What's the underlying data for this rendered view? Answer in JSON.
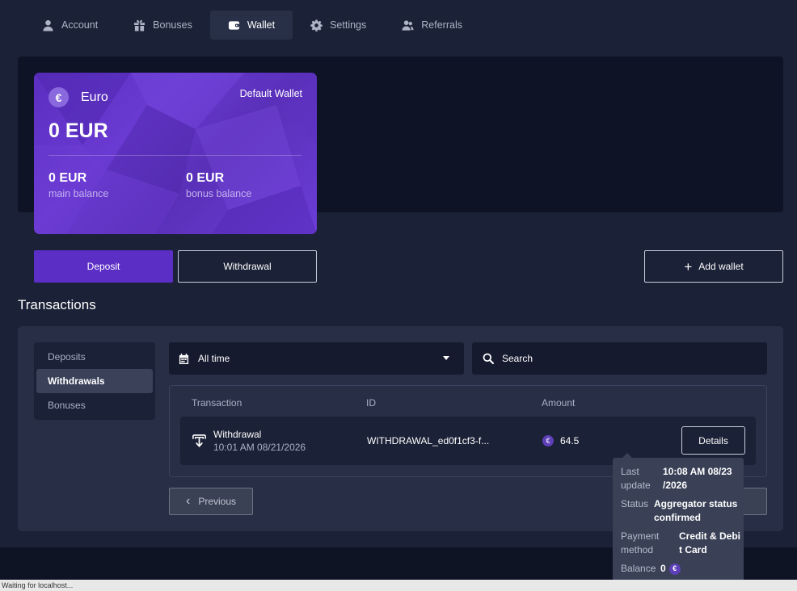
{
  "tabs": [
    {
      "label": "Account",
      "icon": "user-icon"
    },
    {
      "label": "Bonuses",
      "icon": "gift-icon"
    },
    {
      "label": "Wallet",
      "icon": "wallet-icon",
      "active": true
    },
    {
      "label": "Settings",
      "icon": "gear-icon"
    },
    {
      "label": "Referrals",
      "icon": "users-icon"
    }
  ],
  "wallet_card": {
    "currency_symbol": "€",
    "currency": "Euro",
    "default_label": "Default Wallet",
    "total": "0 EUR",
    "main_amount": "0 EUR",
    "main_label": "main balance",
    "bonus_amount": "0 EUR",
    "bonus_label": "bonus balance"
  },
  "actions": {
    "deposit": "Deposit",
    "withdrawal": "Withdrawal",
    "add_wallet": "Add wallet"
  },
  "transactions": {
    "title": "Transactions",
    "menu": [
      {
        "label": "Deposits",
        "active": false
      },
      {
        "label": "Withdrawals",
        "active": true
      },
      {
        "label": "Bonuses",
        "active": false
      }
    ],
    "filter_value": "All time",
    "search_placeholder": "Search",
    "columns": {
      "transaction": "Transaction",
      "id": "ID",
      "amount": "Amount"
    },
    "rows": [
      {
        "type": "Withdrawal",
        "date": "10:01 AM 08/21/2026",
        "id": "WITHDRAWAL_ed0f1cf3-f...",
        "currency_symbol": "€",
        "amount": "64.5",
        "details_label": "Details"
      }
    ],
    "previous_label": "Previous"
  },
  "tooltip": {
    "last_update_label_1": "Last",
    "last_update_label_2": "update",
    "last_update_value_1": "10:08 AM 08/23",
    "last_update_value_2": "/2026",
    "status_label": "Status",
    "status_value_1": "Aggregator status",
    "status_value_2": "confirmed",
    "payment_label_1": "Payment",
    "payment_label_2": "method",
    "payment_value_1": "Credit & Debi",
    "payment_value_2": "t Card",
    "balance_label": "Balance",
    "balance_value": "0",
    "currency_symbol": "€"
  },
  "status_bar": "Waiting for localhost...",
  "colors": {
    "background": "#1b2136",
    "accent": "#5b2ec6",
    "card": "#6a3ad2",
    "panel": "#272e45"
  }
}
